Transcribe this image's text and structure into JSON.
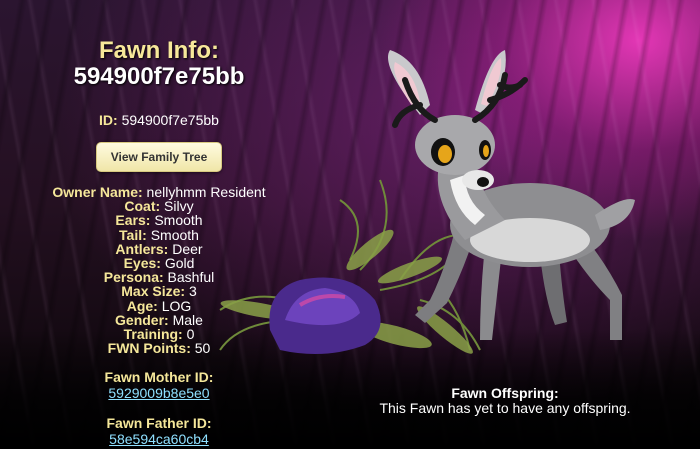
{
  "header": {
    "title": "Fawn Info:",
    "fawn_id": "594900f7e75bb"
  },
  "id_line": {
    "label": "ID:",
    "value": "594900f7e75bb"
  },
  "view_family_tree_button": "View Family Tree",
  "attributes": [
    {
      "label": "Owner Name:",
      "value": "nellyhmm Resident"
    },
    {
      "label": "Coat:",
      "value": "Silvy"
    },
    {
      "label": "Ears:",
      "value": "Smooth"
    },
    {
      "label": "Tail:",
      "value": "Smooth"
    },
    {
      "label": "Antlers:",
      "value": "Deer"
    },
    {
      "label": "Eyes:",
      "value": "Gold"
    },
    {
      "label": "Persona:",
      "value": "Bashful"
    },
    {
      "label": "Max Size:",
      "value": "3"
    },
    {
      "label": "Age:",
      "value": "LOG"
    },
    {
      "label": "Gender:",
      "value": "Male"
    },
    {
      "label": "Training:",
      "value": "0"
    },
    {
      "label": "FWN Points:",
      "value": "50"
    }
  ],
  "mother": {
    "label": "Fawn Mother ID:",
    "value": "5929009b8e5e0"
  },
  "father": {
    "label": "Fawn Father ID:",
    "value": "58e594ca60cb4"
  },
  "offspring": {
    "label": "Fawn Offspring:",
    "text": "This Fawn has yet to have any offspring."
  },
  "colors": {
    "label_yellow": "#f5e79a",
    "link_blue": "#8fe0ff",
    "background_magenta": "#ff3cc8"
  }
}
